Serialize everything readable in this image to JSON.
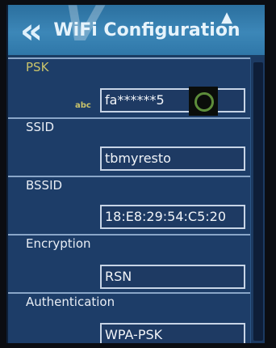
{
  "header": {
    "title": "WiFi Configuration",
    "back_glyph": "«",
    "up_glyph": "▲",
    "logo_glyph": "V"
  },
  "fields": {
    "psk": {
      "label": "PSK",
      "value": "fa******5",
      "input_mode": "abc",
      "toggle_icon": "circle-icon"
    },
    "ssid": {
      "label": "SSID",
      "value": "tbmyresto"
    },
    "bssid": {
      "label": "BSSID",
      "value": "18:E8:29:54:C5:20"
    },
    "encryption": {
      "label": "Encryption",
      "value": "RSN"
    },
    "authentication": {
      "label": "Authentication",
      "value": "WPA-PSK"
    }
  },
  "colors": {
    "header": "#3c87b8",
    "background": "#1d3d68",
    "active_label": "#c9c36b",
    "toggle_ring": "#5d8d3a"
  }
}
